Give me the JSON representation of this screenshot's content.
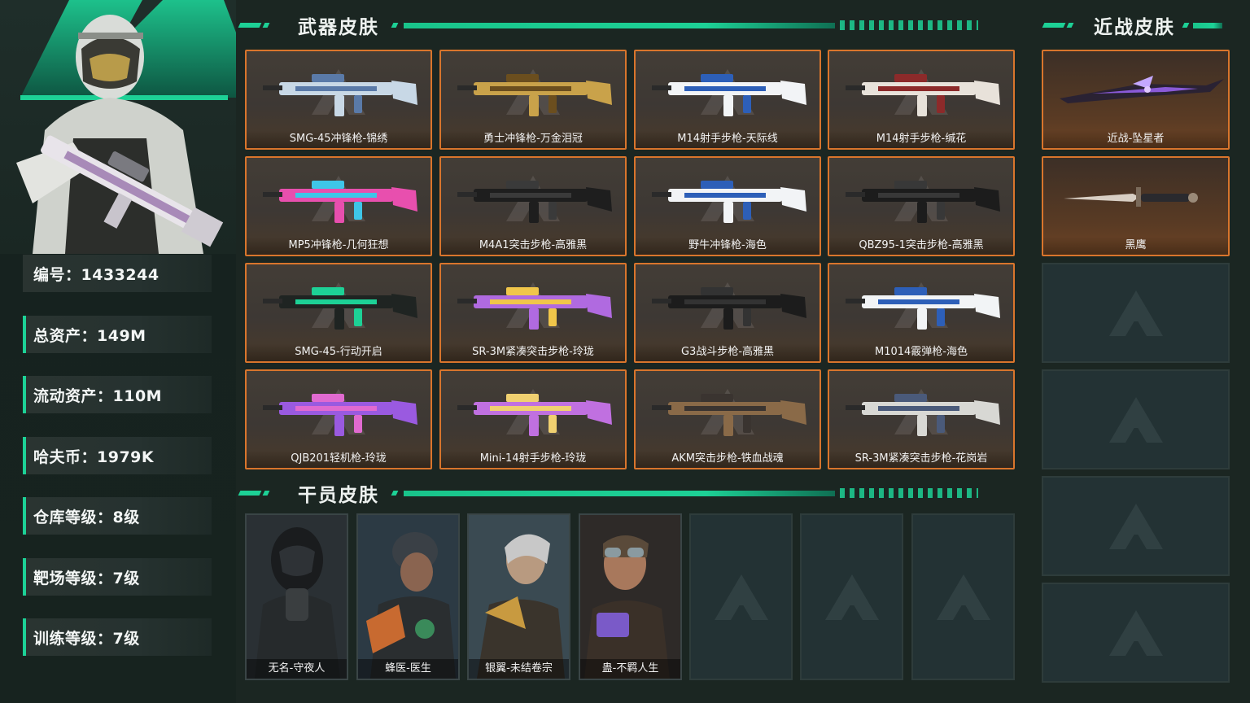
{
  "player": {
    "stats": [
      {
        "label": "编号：1433244"
      },
      {
        "label": "总资产：149M"
      },
      {
        "label": "流动资产：110M"
      },
      {
        "label": "哈夫币：1979K"
      },
      {
        "label": "仓库等级：8级"
      },
      {
        "label": "靶场等级：7级"
      },
      {
        "label": "训练等级：7级"
      }
    ]
  },
  "sections": {
    "weapons_title": "武器皮肤",
    "melee_title": "近战皮肤",
    "agents_title": "干员皮肤"
  },
  "weapons": [
    {
      "name": "SMG-45冲锋枪-锦绣",
      "palette": [
        "#c8d8e6",
        "#5a7aa8"
      ]
    },
    {
      "name": "勇士冲锋枪-万金泪冠",
      "palette": [
        "#c9a24a",
        "#6b4e1e"
      ]
    },
    {
      "name": "M14射手步枪-天际线",
      "palette": [
        "#f2f4f6",
        "#2d5fb8"
      ]
    },
    {
      "name": "M14射手步枪-缄花",
      "palette": [
        "#e8e2da",
        "#8c2a2a"
      ]
    },
    {
      "name": "MP5冲锋枪-几何狂想",
      "palette": [
        "#e84fae",
        "#3ec6e8"
      ]
    },
    {
      "name": "M4A1突击步枪-高雅黑",
      "palette": [
        "#1e1e1e",
        "#3a3a3a"
      ]
    },
    {
      "name": "野牛冲锋枪-海色",
      "palette": [
        "#f2f4f6",
        "#2d5fb8"
      ]
    },
    {
      "name": "QBZ95-1突击步枪-高雅黑",
      "palette": [
        "#1c1c1c",
        "#383838"
      ]
    },
    {
      "name": "SMG-45-行动开启",
      "palette": [
        "#1f2422",
        "#1dd196"
      ]
    },
    {
      "name": "SR-3M紧凑突击步枪-玲珑",
      "palette": [
        "#b06ae0",
        "#f0c64a"
      ]
    },
    {
      "name": "G3战斗步枪-高雅黑",
      "palette": [
        "#1c1c1c",
        "#333333"
      ]
    },
    {
      "name": "M1014霰弹枪-海色",
      "palette": [
        "#f2f4f6",
        "#2d5fb8"
      ]
    },
    {
      "name": "QJB201轻机枪-玲珑",
      "palette": [
        "#9a5ae0",
        "#e06ad0"
      ]
    },
    {
      "name": "Mini-14射手步枪-玲珑",
      "palette": [
        "#c070e0",
        "#f0d070"
      ]
    },
    {
      "name": "AKM突击步枪-铁血战魂",
      "palette": [
        "#8a6a48",
        "#3a3430"
      ]
    },
    {
      "name": "SR-3M紧凑突击步枪-花岗岩",
      "palette": [
        "#d8d8d4",
        "#4a5a7a"
      ]
    }
  ],
  "melee": [
    {
      "name": "近战-坠星者"
    },
    {
      "name": "黑鹰"
    }
  ],
  "agents": [
    {
      "name": "无名-守夜人"
    },
    {
      "name": "蜂医-医生"
    },
    {
      "name": "银翼-未结卷宗"
    },
    {
      "name": "蛊-不羁人生"
    }
  ],
  "colors": {
    "accent": "#1dd196",
    "card_border": "#d9752c",
    "background": "#1b2622"
  }
}
